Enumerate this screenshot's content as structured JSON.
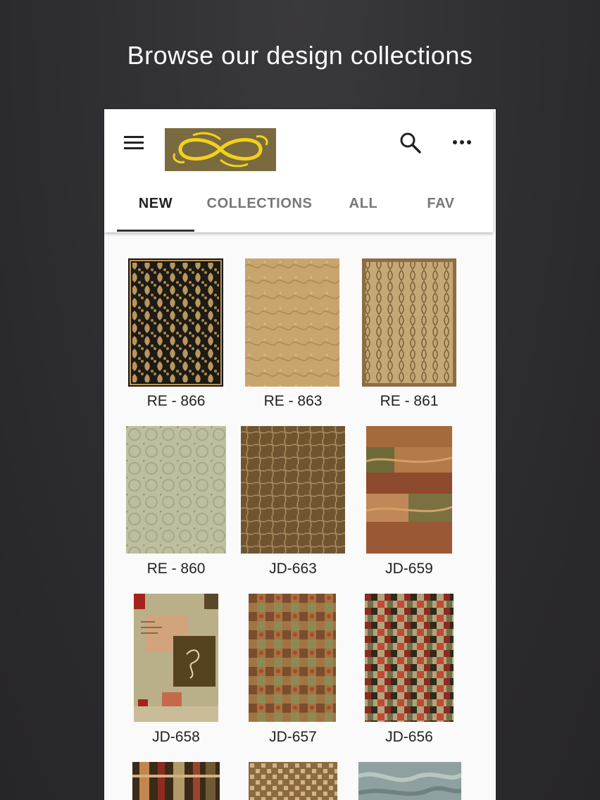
{
  "headline": "Browse our design collections",
  "icons": {
    "menu": "hamburger-menu-icon",
    "search": "search-icon",
    "more": "more-horizontal-icon"
  },
  "colors": {
    "background": "#2e2d30",
    "logo_bg": "#7a6a40",
    "logo_fg": "#f2d21b",
    "tab_active": "#222222",
    "tab_inactive": "#777777"
  },
  "tabs": [
    {
      "label": "NEW",
      "active": true
    },
    {
      "label": "COLLECTIONS",
      "active": false
    },
    {
      "label": "ALL",
      "active": false
    },
    {
      "label": "FAV",
      "active": false
    }
  ],
  "products": [
    {
      "code": "RE - 866"
    },
    {
      "code": "RE - 863"
    },
    {
      "code": "RE - 861"
    },
    {
      "code": "RE - 860"
    },
    {
      "code": "JD-663"
    },
    {
      "code": "JD-659"
    },
    {
      "code": "JD-658"
    },
    {
      "code": "JD-657"
    },
    {
      "code": "JD-656"
    },
    {
      "code": ""
    },
    {
      "code": ""
    },
    {
      "code": ""
    }
  ]
}
